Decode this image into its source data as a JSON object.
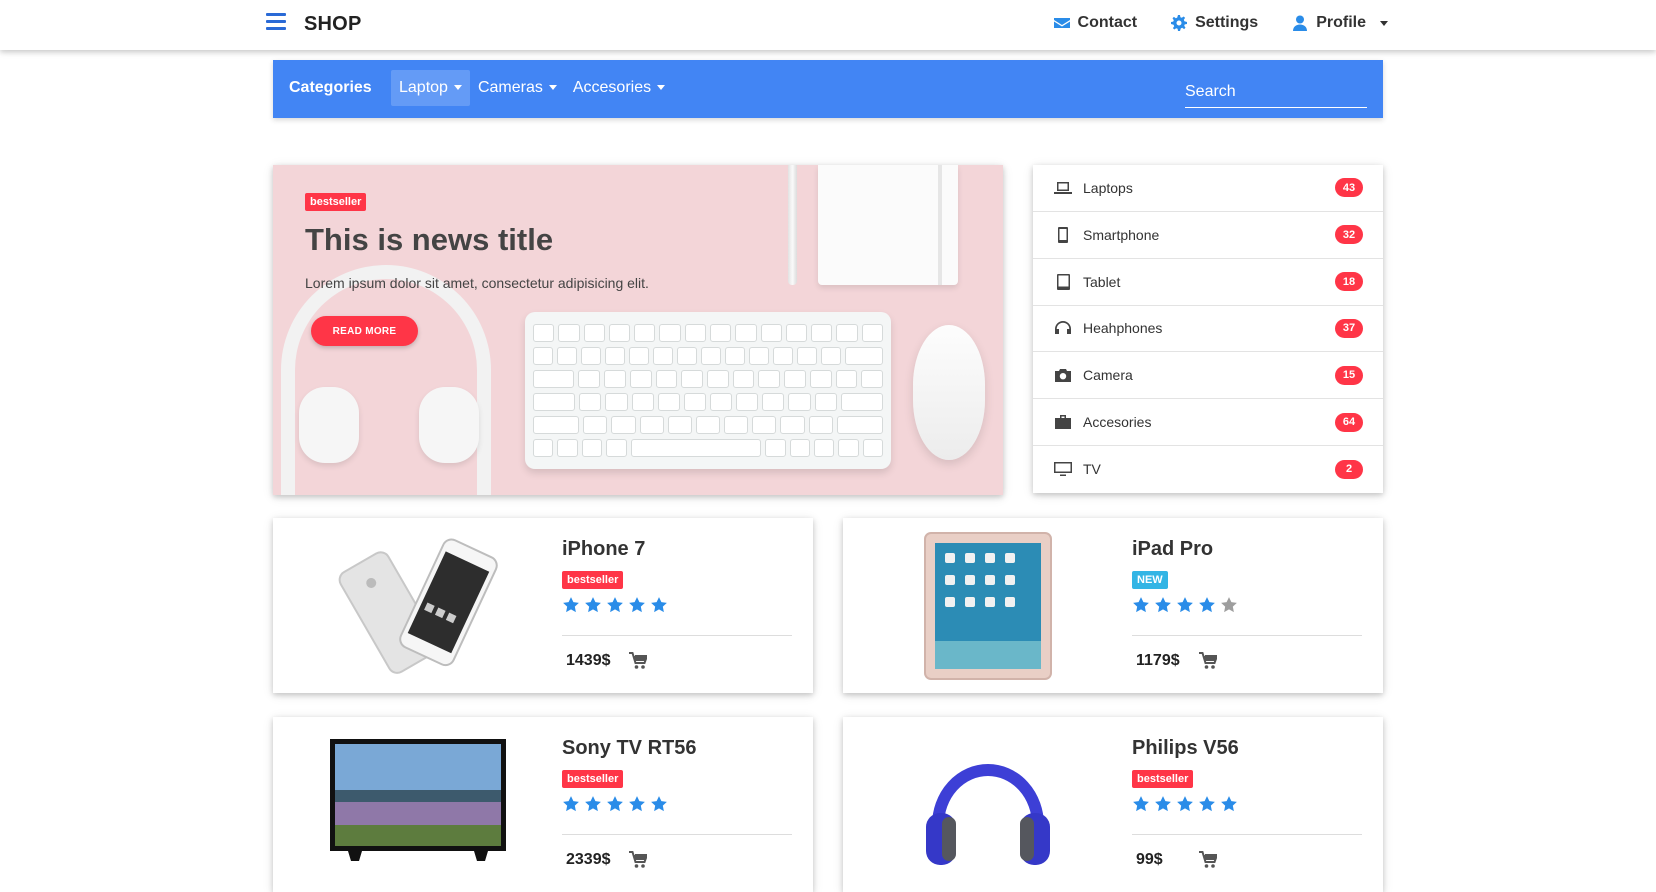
{
  "header": {
    "brand": "SHOP",
    "nav": [
      {
        "label": "Contact",
        "icon": "envelope-icon"
      },
      {
        "label": "Settings",
        "icon": "gear-icon"
      },
      {
        "label": "Profile",
        "icon": "user-icon"
      }
    ]
  },
  "categories_bar": {
    "title": "Categories",
    "menu": [
      {
        "label": "Laptop",
        "active": true
      },
      {
        "label": "Cameras",
        "active": false
      },
      {
        "label": "Accesories",
        "active": false
      }
    ],
    "search_placeholder": "Search"
  },
  "hero": {
    "badge": "bestseller",
    "title": "This is news title",
    "text": "Lorem ipsum dolor sit amet, consectetur adipisicing elit.",
    "button": "READ MORE"
  },
  "category_list": [
    {
      "label": "Laptops",
      "count": "43",
      "icon": "laptop-icon"
    },
    {
      "label": "Smartphone",
      "count": "32",
      "icon": "smartphone-icon"
    },
    {
      "label": "Tablet",
      "count": "18",
      "icon": "tablet-icon"
    },
    {
      "label": "Heahphones",
      "count": "37",
      "icon": "headphones-icon"
    },
    {
      "label": "Camera",
      "count": "15",
      "icon": "camera-icon"
    },
    {
      "label": "Accesories",
      "count": "64",
      "icon": "suitcase-icon"
    },
    {
      "label": "TV",
      "count": "2",
      "icon": "tv-icon"
    }
  ],
  "products": [
    {
      "name": "iPhone 7",
      "badge": "bestseller",
      "badge_type": "red",
      "rating": 5,
      "price": "1439$"
    },
    {
      "name": "iPad Pro",
      "badge": "NEW",
      "badge_type": "blue",
      "rating": 4,
      "price": "1179$"
    },
    {
      "name": "Sony TV RT56",
      "badge": "bestseller",
      "badge_type": "red",
      "rating": 5,
      "price": "2339$"
    },
    {
      "name": "Philips V56",
      "badge": "bestseller",
      "badge_type": "red",
      "rating": 5,
      "price": "99$"
    }
  ],
  "colors": {
    "primary": "#4285f4",
    "danger": "#ff3547",
    "info": "#33b5e5",
    "star_active": "#2a8ce8",
    "star_inactive": "#9e9e9e"
  }
}
